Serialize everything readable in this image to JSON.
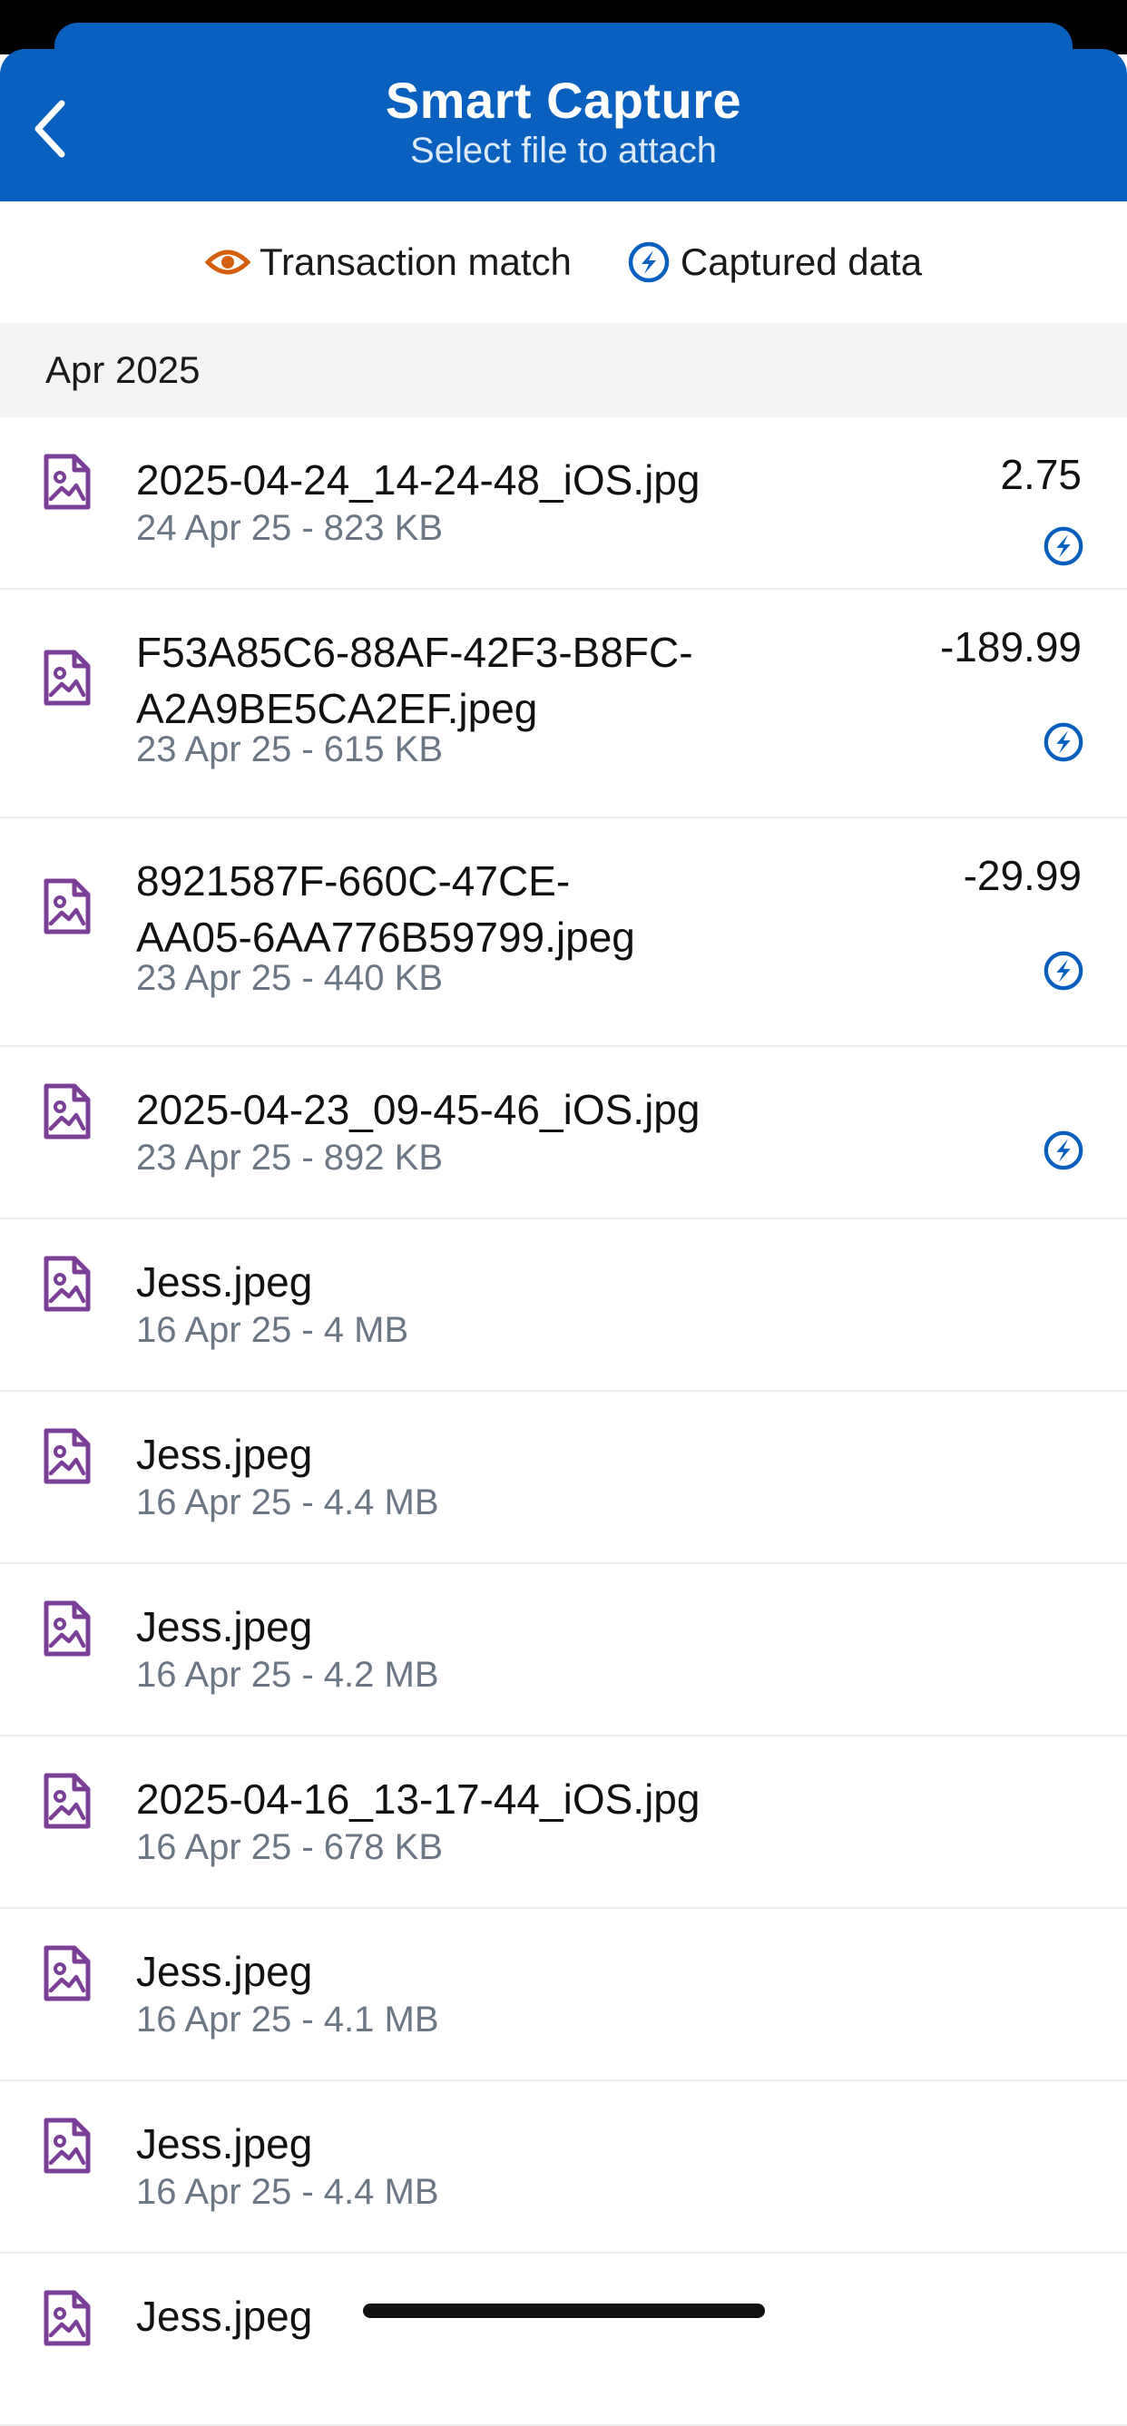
{
  "header": {
    "title": "Smart Capture",
    "subtitle": "Select file to attach",
    "back_icon": "chevron-left-icon"
  },
  "legend": {
    "transaction_match": {
      "label": "Transaction match",
      "icon": "eye-icon",
      "color": "#d4600f"
    },
    "captured_data": {
      "label": "Captured data",
      "icon": "lightning-circle-icon",
      "color": "#0a60bf"
    }
  },
  "section": {
    "label": "Apr 2025"
  },
  "colors": {
    "header_bg": "#0a60bf",
    "file_icon": "#7b3f98",
    "captured_icon": "#0a60bf",
    "meta_text": "#6b7785"
  },
  "files": [
    {
      "name_lines": [
        "2025-04-24_14-24-48_iOS.jpg"
      ],
      "meta": "24 Apr 25 - 823 KB",
      "amount": "2.75",
      "captured": true
    },
    {
      "name_lines": [
        "F53A85C6-88AF-42F3-B8FC-",
        "A2A9BE5CA2EF.jpeg"
      ],
      "meta": "23 Apr 25 - 615 KB",
      "amount": "-189.99",
      "captured": true
    },
    {
      "name_lines": [
        "8921587F-660C-47CE-",
        "AA05-6AA776B59799.jpeg"
      ],
      "meta": "23 Apr 25 - 440 KB",
      "amount": "-29.99",
      "captured": true
    },
    {
      "name_lines": [
        "2025-04-23_09-45-46_iOS.jpg"
      ],
      "meta": "23 Apr 25 - 892 KB",
      "amount": "",
      "captured": true
    },
    {
      "name_lines": [
        "Jess.jpeg"
      ],
      "meta": "16 Apr 25 - 4 MB",
      "amount": "",
      "captured": false
    },
    {
      "name_lines": [
        "Jess.jpeg"
      ],
      "meta": "16 Apr 25 - 4.4 MB",
      "amount": "",
      "captured": false
    },
    {
      "name_lines": [
        "Jess.jpeg"
      ],
      "meta": "16 Apr 25 - 4.2 MB",
      "amount": "",
      "captured": false
    },
    {
      "name_lines": [
        "2025-04-16_13-17-44_iOS.jpg"
      ],
      "meta": "16 Apr 25 - 678 KB",
      "amount": "",
      "captured": false
    },
    {
      "name_lines": [
        "Jess.jpeg"
      ],
      "meta": "16 Apr 25 - 4.1 MB",
      "amount": "",
      "captured": false
    },
    {
      "name_lines": [
        "Jess.jpeg"
      ],
      "meta": "16 Apr 25 - 4.4 MB",
      "amount": "",
      "captured": false
    },
    {
      "name_lines": [
        "Jess.jpeg"
      ],
      "meta": "",
      "amount": "",
      "captured": false
    }
  ]
}
